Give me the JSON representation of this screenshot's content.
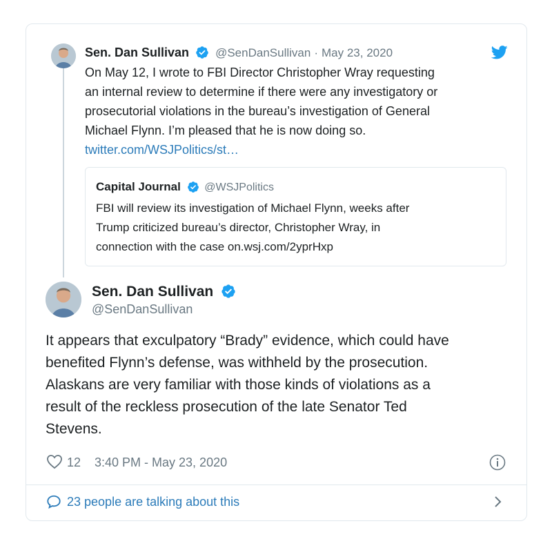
{
  "quoted_tweet": {
    "author_name": "Sen. Dan Sullivan",
    "handle": "@SenDanSullivan",
    "separator": "·",
    "date": "May 23, 2020",
    "text_lines": [
      "On May 12, I wrote to FBI Director Christopher Wray requesting",
      "an internal review to determine if there were any investigatory or",
      "prosecutorial violations in the bureau’s investigation of General",
      "Michael Flynn. I’m pleased that he is now doing so."
    ],
    "link": "twitter.com/WSJPolitics/st…",
    "nested_quote": {
      "author_name": "Capital Journal",
      "handle": "@WSJPolitics",
      "text_lines": [
        "FBI will review its investigation of Michael Flynn, weeks after",
        "Trump criticized bureau’s director, Christopher Wray, in",
        "connection with the case on.wsj.com/2yprHxp"
      ]
    }
  },
  "main_tweet": {
    "author_name": "Sen. Dan Sullivan",
    "handle": "@SenDanSullivan",
    "text_lines": [
      "It appears that exculpatory “Brady” evidence, which could have",
      "benefited Flynn’s defense, was withheld by the prosecution.",
      "Alaskans are very familiar with those kinds of violations as a",
      "result of the reckless prosecution of the late Senator Ted",
      "Stevens."
    ],
    "like_count": "12",
    "timestamp": "3:40 PM - May 23, 2020"
  },
  "footer": {
    "talking_text": "23 people are talking about this"
  },
  "icons": {
    "twitter_logo": "twitter-bird-icon",
    "verified": "verified-badge-icon",
    "like": "heart-icon",
    "info": "info-icon",
    "conversation": "comment-bubble-icon",
    "chevron": "chevron-right-icon"
  },
  "colors": {
    "twitter_blue": "#1da1f2",
    "link": "#2b7bb9",
    "text": "#1c2022",
    "secondary": "#697882",
    "border": "#e1e8ed"
  }
}
